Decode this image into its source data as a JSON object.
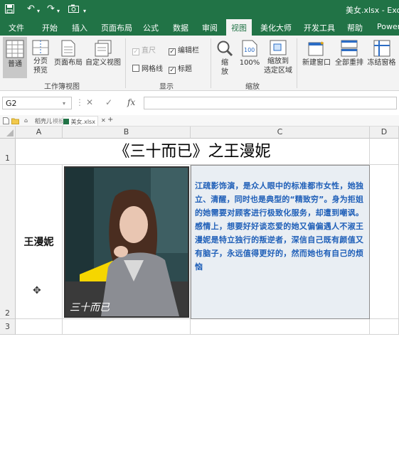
{
  "app": {
    "title": "美女.xlsx - Excel"
  },
  "tabs": [
    {
      "label": "文件",
      "active": false
    },
    {
      "label": "开始",
      "active": false
    },
    {
      "label": "插入",
      "active": false
    },
    {
      "label": "页面布局",
      "active": false
    },
    {
      "label": "公式",
      "active": false
    },
    {
      "label": "数据",
      "active": false
    },
    {
      "label": "审阅",
      "active": false
    },
    {
      "label": "视图",
      "active": true
    },
    {
      "label": "美化大师",
      "active": false
    },
    {
      "label": "开发工具",
      "active": false
    },
    {
      "label": "帮助",
      "active": false
    },
    {
      "label": "Power",
      "active": false
    }
  ],
  "ribbon": {
    "group_workbook_views": {
      "label": "工作簿视图",
      "normal": "普通",
      "page_break_1": "分页",
      "page_break_2": "预览",
      "page_layout": "页面布局",
      "custom_view": "自定义视图"
    },
    "group_show": {
      "label": "显示",
      "ruler": "直尺",
      "formula_bar": "编辑栏",
      "gridlines": "网格线",
      "headings": "标题",
      "ruler_checked": true,
      "formula_bar_checked": true,
      "gridlines_checked": false,
      "headings_checked": true
    },
    "group_zoom": {
      "label": "缩放",
      "zoom_1": "缩",
      "zoom_2": "放",
      "zoom_100": "100%",
      "zoom_sel_1": "缩放到",
      "zoom_sel_2": "选定区域"
    },
    "group_window": {
      "new_window": "新建窗口",
      "arrange_all": "全部重排",
      "freeze_panes": "冻结窗格"
    }
  },
  "formula_bar": {
    "name_box": "G2",
    "fx": "fx",
    "value": ""
  },
  "file_tabs": [
    {
      "label": "稻壳儿"
    },
    {
      "label": "模板专区"
    },
    {
      "label": "美女.xlsx"
    }
  ],
  "sheet": {
    "columns": [
      "A",
      "B",
      "C",
      "D"
    ],
    "rows": [
      "1",
      "2",
      "3"
    ],
    "title": "《三十而已》之王漫妮",
    "name": "王漫妮",
    "description": "江疏影饰演，是众人眼中的标准都市女性，她独立、清醒，同时也是典型的“精致穷”。身为拒姐的她需要对顾客进行极致化服务，却遭到嘲讽。感情上，想要好好谈恋爱的她又偏偏遇人不淑王漫妮是特立独行的叛逆者，深信自己既有颜值又有脑子，永远值得更好的，然而她也有自己的烦恼",
    "photo_caption": "三十而已"
  }
}
